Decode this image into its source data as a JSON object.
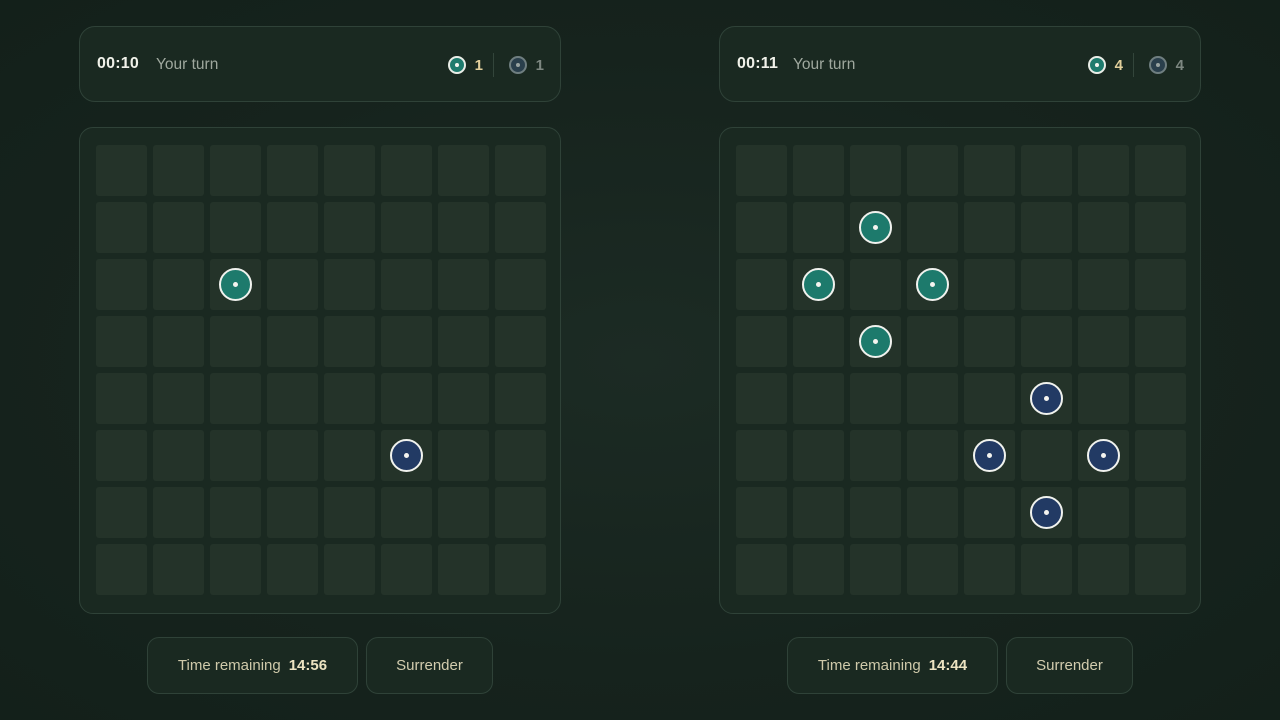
{
  "games": [
    {
      "timer": "00:10",
      "turn_label": "Your turn",
      "score_player": "1",
      "score_opponent": "1",
      "pieces": [
        {
          "row": 2,
          "col": 2,
          "player": "p1"
        },
        {
          "row": 5,
          "col": 5,
          "player": "p2"
        }
      ],
      "time_remaining_label": "Time remaining",
      "time_remaining_value": "14:56",
      "surrender_label": "Surrender"
    },
    {
      "timer": "00:11",
      "turn_label": "Your turn",
      "score_player": "4",
      "score_opponent": "4",
      "pieces": [
        {
          "row": 1,
          "col": 2,
          "player": "p1"
        },
        {
          "row": 2,
          "col": 1,
          "player": "p1"
        },
        {
          "row": 2,
          "col": 3,
          "player": "p1"
        },
        {
          "row": 3,
          "col": 2,
          "player": "p1"
        },
        {
          "row": 4,
          "col": 5,
          "player": "p2"
        },
        {
          "row": 5,
          "col": 4,
          "player": "p2"
        },
        {
          "row": 5,
          "col": 6,
          "player": "p2"
        },
        {
          "row": 6,
          "col": 5,
          "player": "p2"
        }
      ],
      "time_remaining_label": "Time remaining",
      "time_remaining_value": "14:44",
      "surrender_label": "Surrender"
    }
  ],
  "board": {
    "rows": 8,
    "cols": 8
  },
  "colors": {
    "background": "#16231d",
    "cell": "#243329",
    "player_piece": "#1d7a6c",
    "opponent_piece": "#223a64",
    "score_highlight": "#e2cf9b"
  },
  "icons": {
    "player_piece": "teal-piece-icon",
    "opponent_piece": "navy-piece-icon"
  }
}
